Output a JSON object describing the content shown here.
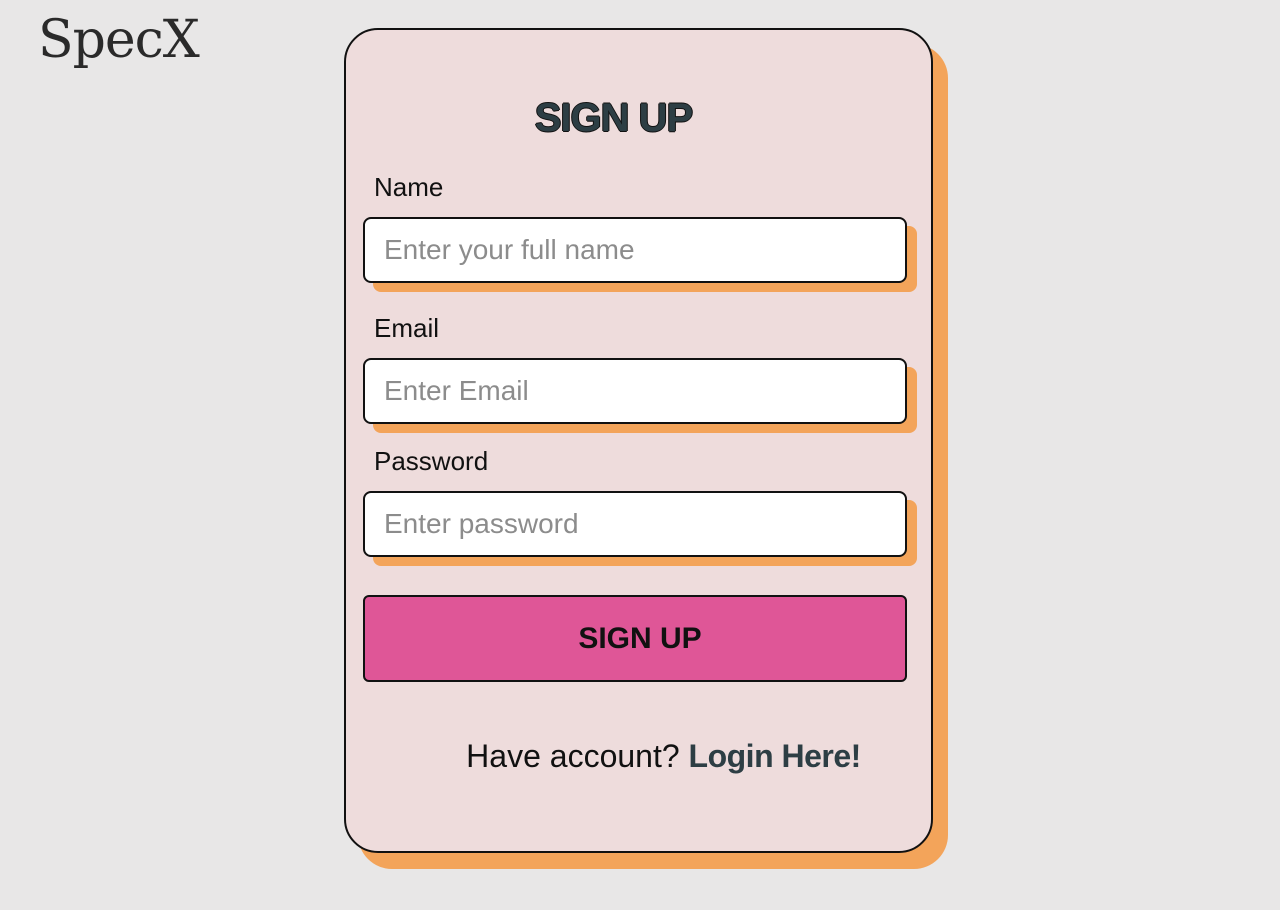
{
  "brand": {
    "logo_text": "SpecX"
  },
  "form": {
    "title": "SIGN UP",
    "fields": [
      {
        "label": "Name",
        "placeholder": "Enter your full name",
        "value": ""
      },
      {
        "label": "Email",
        "placeholder": "Enter Email",
        "value": ""
      },
      {
        "label": "Password",
        "placeholder": "Enter password",
        "value": ""
      }
    ],
    "submit_label": "SIGN UP",
    "footer_text": "Have account?",
    "login_link_label": "Login Here!"
  },
  "colors": {
    "background": "#e8e7e7",
    "card": "#eedcdc",
    "accent_shadow": "#f3a45a",
    "button": "#df5697",
    "title_text": "#2d3e44"
  }
}
